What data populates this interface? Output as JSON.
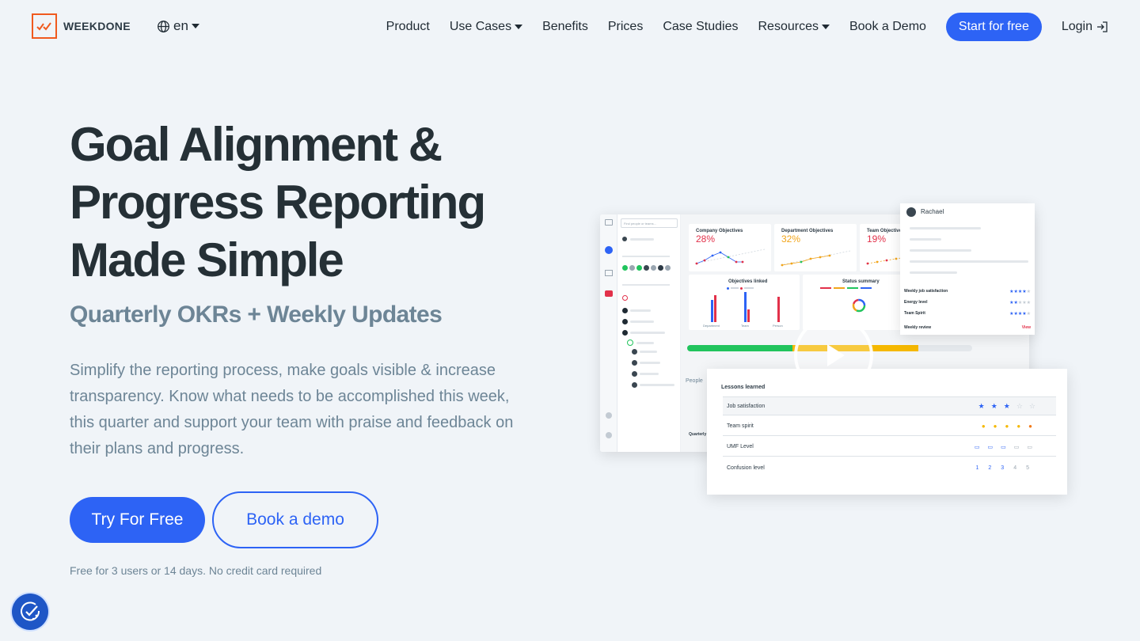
{
  "nav": {
    "logo_text": "WEEKDONE",
    "lang": "en",
    "items": [
      {
        "label": "Product",
        "dropdown": false
      },
      {
        "label": "Use Cases",
        "dropdown": true
      },
      {
        "label": "Benefits",
        "dropdown": false
      },
      {
        "label": "Prices",
        "dropdown": false
      },
      {
        "label": "Case Studies",
        "dropdown": false
      },
      {
        "label": "Resources",
        "dropdown": true
      },
      {
        "label": "Book a Demo",
        "dropdown": false
      }
    ],
    "start_label": "Start for free",
    "login_label": "Login"
  },
  "hero": {
    "title": "Goal Alignment & Progress Reporting Made Simple",
    "subtitle": "Quarterly OKRs + Weekly Updates",
    "description": "Simplify the reporting process, make goals visible & increase transparency. Know what needs to be accomplished this week, this quarter and support your team with praise and feedback on their plans and progress.",
    "try_label": "Try For Free",
    "demo_label": "Book a demo",
    "note": "Free for 3 users or 14 days. No credit card required"
  },
  "mockup": {
    "search_placeholder": "Find people or teams...",
    "objectives": [
      {
        "title": "Company Objectives",
        "pct": "28%",
        "color": "#e2314a"
      },
      {
        "title": "Department Objectives",
        "pct": "32%",
        "color": "#f2a51a"
      },
      {
        "title": "Team Objectives",
        "pct": "19%",
        "color": "#e2314a"
      }
    ],
    "linked_title": "Objectives linked",
    "status_title": "Status summary",
    "bar_labels": [
      "Department",
      "Team",
      "Person"
    ],
    "people_label": "People",
    "quarterly_label": "Quarterly",
    "progress": {
      "green": 0.37,
      "yellow": 0.44
    },
    "profile": {
      "name": "Rachael",
      "rows": [
        {
          "label": "Weekly job satisfaction",
          "stars": 4
        },
        {
          "label": "Energy level",
          "stars": 2
        },
        {
          "label": "Team Spirit",
          "stars": 4
        }
      ],
      "review_label": "Weekly review",
      "view_label": "View"
    },
    "lessons": {
      "title": "Lessons learned",
      "rows": [
        {
          "label": "Job satisfaction",
          "marks": [
            "★",
            "★",
            "★",
            "☆",
            "☆"
          ]
        },
        {
          "label": "Team spirit",
          "marks": [
            "●",
            "●",
            "●",
            "●",
            "●"
          ]
        },
        {
          "label": "UMF Level",
          "marks": [
            "▭",
            "▭",
            "▭",
            "▭",
            "▭"
          ]
        },
        {
          "label": "Confusion level",
          "marks": [
            "1",
            "2",
            "3",
            "4",
            "5"
          ]
        }
      ]
    }
  },
  "colors": {
    "accent": "#2d63f5",
    "brand_orange": "#f05a1e",
    "green": "#21c45d",
    "yellow": "#f5b800"
  }
}
